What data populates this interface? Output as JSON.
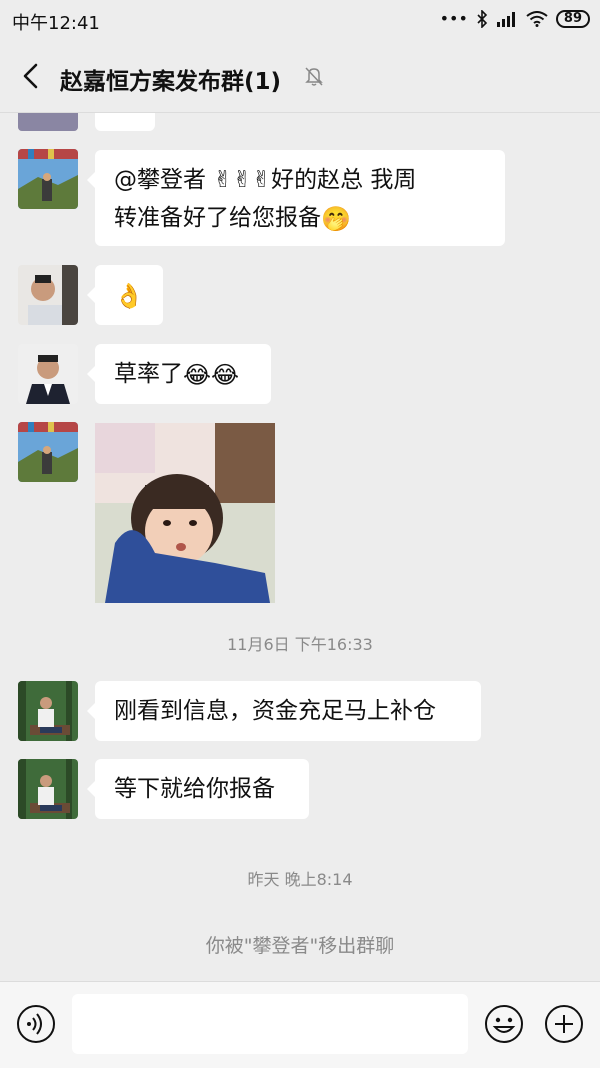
{
  "status_bar": {
    "time": "中午12:41",
    "signal_text": "•••",
    "battery": "89"
  },
  "header": {
    "title": "赵嘉恒方案发布群(1)",
    "back_icon": "chevron-left-icon",
    "mute_icon": "bell-off-icon"
  },
  "messages": [
    {
      "sender": "partial",
      "text": ""
    },
    {
      "sender": "landscape-avatar",
      "text_line1": "@攀登者 ✌✌✌好的赵总  我周",
      "text_line2": "转准备好了给您报备",
      "emoji_end": "🤭"
    },
    {
      "sender": "man-glasses",
      "emoji": "👌"
    },
    {
      "sender": "man-suit",
      "text": "草率了",
      "emojis": "😂😂"
    },
    {
      "sender": "landscape-avatar",
      "sticker": "child-sticker"
    },
    {
      "sender": "man-forest",
      "text": "刚看到信息，资金充足马上补仓"
    },
    {
      "sender": "man-forest",
      "text": "等下就给你报备"
    }
  ],
  "timestamps": [
    "11月6日 下午16:33",
    "昨天 晚上8:14"
  ],
  "system_note": "你被\"攀登者\"移出群聊",
  "input_bar": {
    "voice_icon": "voice-icon",
    "emoji_icon": "smiley-icon",
    "plus_icon": "plus-icon"
  }
}
